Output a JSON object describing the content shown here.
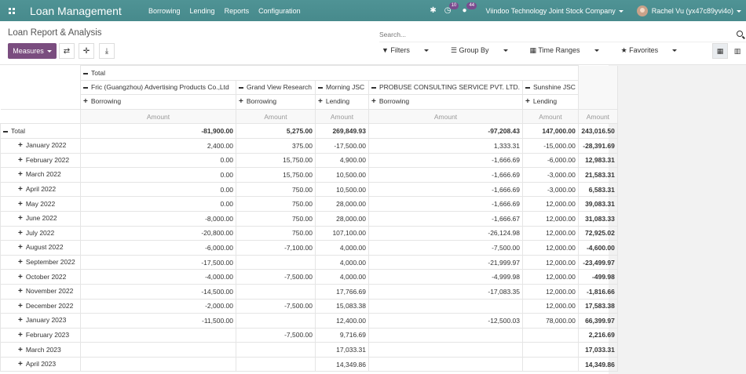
{
  "navbar": {
    "app_title": "Loan Management",
    "menu": [
      "Borrowing",
      "Lending",
      "Reports",
      "Configuration"
    ],
    "activity_badge": "10",
    "messages_badge": "44",
    "company": "Viindoo Technology Joint Stock Company",
    "user": "Rachel Vu (yx47c89yvi4o)"
  },
  "control_panel": {
    "breadcrumb": "Loan Report & Analysis",
    "search_placeholder": "Search...",
    "measures_label": "Measures",
    "filters_label": "Filters",
    "group_by_label": "Group By",
    "time_ranges_label": "Time Ranges",
    "favorites_label": "Favorites"
  },
  "pivot": {
    "total_label": "Total",
    "measure_label": "Amount",
    "columns": [
      {
        "partner": "Fric (Guangzhou) Advertising Products Co.,Ltd",
        "type": "Borrowing"
      },
      {
        "partner": "Grand View Research",
        "type": "Borrowing"
      },
      {
        "partner": "Morning JSC",
        "type": "Lending"
      },
      {
        "partner": "PROBUSE CONSULTING SERVICE PVT. LTD.",
        "type": "Borrowing"
      },
      {
        "partner": "Sunshine JSC",
        "type": "Lending"
      }
    ],
    "rows": [
      {
        "label": "Total",
        "values": [
          "-81,900.00",
          "5,275.00",
          "269,849.93",
          "-97,208.43",
          "147,000.00",
          "243,016.50"
        ]
      },
      {
        "label": "January 2022",
        "values": [
          "2,400.00",
          "375.00",
          "-17,500.00",
          "1,333.31",
          "-15,000.00",
          "-28,391.69"
        ]
      },
      {
        "label": "February 2022",
        "values": [
          "0.00",
          "15,750.00",
          "4,900.00",
          "-1,666.69",
          "-6,000.00",
          "12,983.31"
        ]
      },
      {
        "label": "March 2022",
        "values": [
          "0.00",
          "15,750.00",
          "10,500.00",
          "-1,666.69",
          "-3,000.00",
          "21,583.31"
        ]
      },
      {
        "label": "April 2022",
        "values": [
          "0.00",
          "750.00",
          "10,500.00",
          "-1,666.69",
          "-3,000.00",
          "6,583.31"
        ]
      },
      {
        "label": "May 2022",
        "values": [
          "0.00",
          "750.00",
          "28,000.00",
          "-1,666.69",
          "12,000.00",
          "39,083.31"
        ]
      },
      {
        "label": "June 2022",
        "values": [
          "-8,000.00",
          "750.00",
          "28,000.00",
          "-1,666.67",
          "12,000.00",
          "31,083.33"
        ]
      },
      {
        "label": "July 2022",
        "values": [
          "-20,800.00",
          "750.00",
          "107,100.00",
          "-26,124.98",
          "12,000.00",
          "72,925.02"
        ]
      },
      {
        "label": "August 2022",
        "values": [
          "-6,000.00",
          "-7,100.00",
          "4,000.00",
          "-7,500.00",
          "12,000.00",
          "-4,600.00"
        ]
      },
      {
        "label": "September 2022",
        "values": [
          "-17,500.00",
          "",
          "4,000.00",
          "-21,999.97",
          "12,000.00",
          "-23,499.97"
        ]
      },
      {
        "label": "October 2022",
        "values": [
          "-4,000.00",
          "-7,500.00",
          "4,000.00",
          "-4,999.98",
          "12,000.00",
          "-499.98"
        ]
      },
      {
        "label": "November 2022",
        "values": [
          "-14,500.00",
          "",
          "17,766.69",
          "-17,083.35",
          "12,000.00",
          "-1,816.66"
        ]
      },
      {
        "label": "December 2022",
        "values": [
          "-2,000.00",
          "-7,500.00",
          "15,083.38",
          "",
          "12,000.00",
          "17,583.38"
        ]
      },
      {
        "label": "January 2023",
        "values": [
          "-11,500.00",
          "",
          "12,400.00",
          "-12,500.03",
          "78,000.00",
          "66,399.97"
        ]
      },
      {
        "label": "February 2023",
        "values": [
          "",
          "-7,500.00",
          "9,716.69",
          "",
          "",
          "2,216.69"
        ]
      },
      {
        "label": "March 2023",
        "values": [
          "",
          "",
          "17,033.31",
          "",
          "",
          "17,033.31"
        ]
      },
      {
        "label": "April 2023",
        "values": [
          "",
          "",
          "14,349.86",
          "",
          "",
          "14,349.86"
        ]
      }
    ]
  }
}
